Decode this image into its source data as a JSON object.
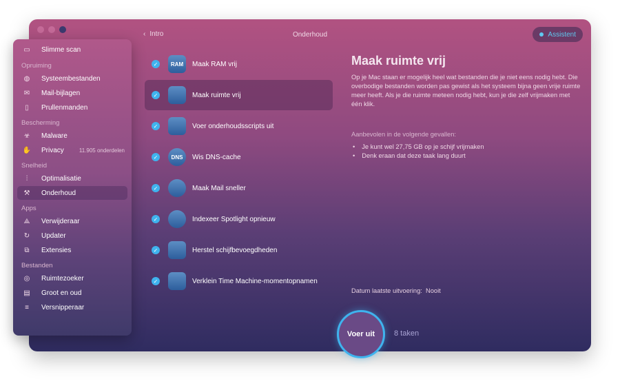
{
  "window": {
    "title": "Onderhoud",
    "back_label": "Intro",
    "assistant_label": "Assistent"
  },
  "sidebar": {
    "top": {
      "label": "Slimme scan",
      "icon": "scan-icon"
    },
    "sections": [
      {
        "title": "Opruiming",
        "items": [
          {
            "label": "Systeembestanden",
            "icon": "system-junk-icon"
          },
          {
            "label": "Mail-bijlagen",
            "icon": "mail-icon"
          },
          {
            "label": "Prullenmanden",
            "icon": "trash-icon"
          }
        ]
      },
      {
        "title": "Bescherming",
        "items": [
          {
            "label": "Malware",
            "icon": "biohazard-icon"
          },
          {
            "label": "Privacy",
            "icon": "hand-icon",
            "count": "11.905 onderdelen"
          }
        ]
      },
      {
        "title": "Snelheid",
        "items": [
          {
            "label": "Optimalisatie",
            "icon": "sliders-icon"
          },
          {
            "label": "Onderhoud",
            "icon": "wrench-icon",
            "selected": true
          }
        ]
      },
      {
        "title": "Apps",
        "items": [
          {
            "label": "Verwijderaar",
            "icon": "uninstaller-icon"
          },
          {
            "label": "Updater",
            "icon": "updater-icon"
          },
          {
            "label": "Extensies",
            "icon": "puzzle-icon"
          }
        ]
      },
      {
        "title": "Bestanden",
        "items": [
          {
            "label": "Ruimtezoeker",
            "icon": "space-lens-icon"
          },
          {
            "label": "Groot en oud",
            "icon": "folder-icon"
          },
          {
            "label": "Versnipperaar",
            "icon": "shredder-icon"
          }
        ]
      }
    ]
  },
  "tasks": [
    {
      "label": "Maak RAM vrij",
      "icon_text": "RAM",
      "checked": true
    },
    {
      "label": "Maak ruimte vrij",
      "icon_text": "",
      "checked": true,
      "selected": true
    },
    {
      "label": "Voer onderhoudsscripts uit",
      "icon_text": "",
      "checked": true
    },
    {
      "label": "Wis DNS-cache",
      "icon_text": "DNS",
      "checked": true
    },
    {
      "label": "Maak Mail sneller",
      "icon_text": "",
      "checked": true
    },
    {
      "label": "Indexeer Spotlight opnieuw",
      "icon_text": "",
      "checked": true
    },
    {
      "label": "Herstel schijfbevoegdheden",
      "icon_text": "",
      "checked": true
    },
    {
      "label": "Verklein Time Machine-momentopnamen",
      "icon_text": "",
      "checked": true
    }
  ],
  "detail": {
    "title": "Maak ruimte vrij",
    "description": "Op je Mac staan er mogelijk heel wat bestanden die je niet eens nodig hebt. Die overbodige bestanden worden pas gewist als het systeem bijna geen vrije ruimte meer heeft. Als je die ruimte meteen nodig hebt, kun je die zelf vrijmaken met één klik.",
    "recommended_title": "Aanbevolen in de volgende gevallen:",
    "bullets": [
      "Je kunt wel 27,75 GB op je schijf vrijmaken",
      "Denk eraan dat deze taak lang duurt"
    ],
    "last_run_label": "Datum laatste uitvoering:",
    "last_run_value": "Nooit"
  },
  "footer": {
    "run_label": "Voer uit",
    "task_count": "8 taken"
  },
  "colors": {
    "accent": "#3fb3ee",
    "gradient_top": "#b15281",
    "gradient_bottom": "#2f2c60"
  }
}
